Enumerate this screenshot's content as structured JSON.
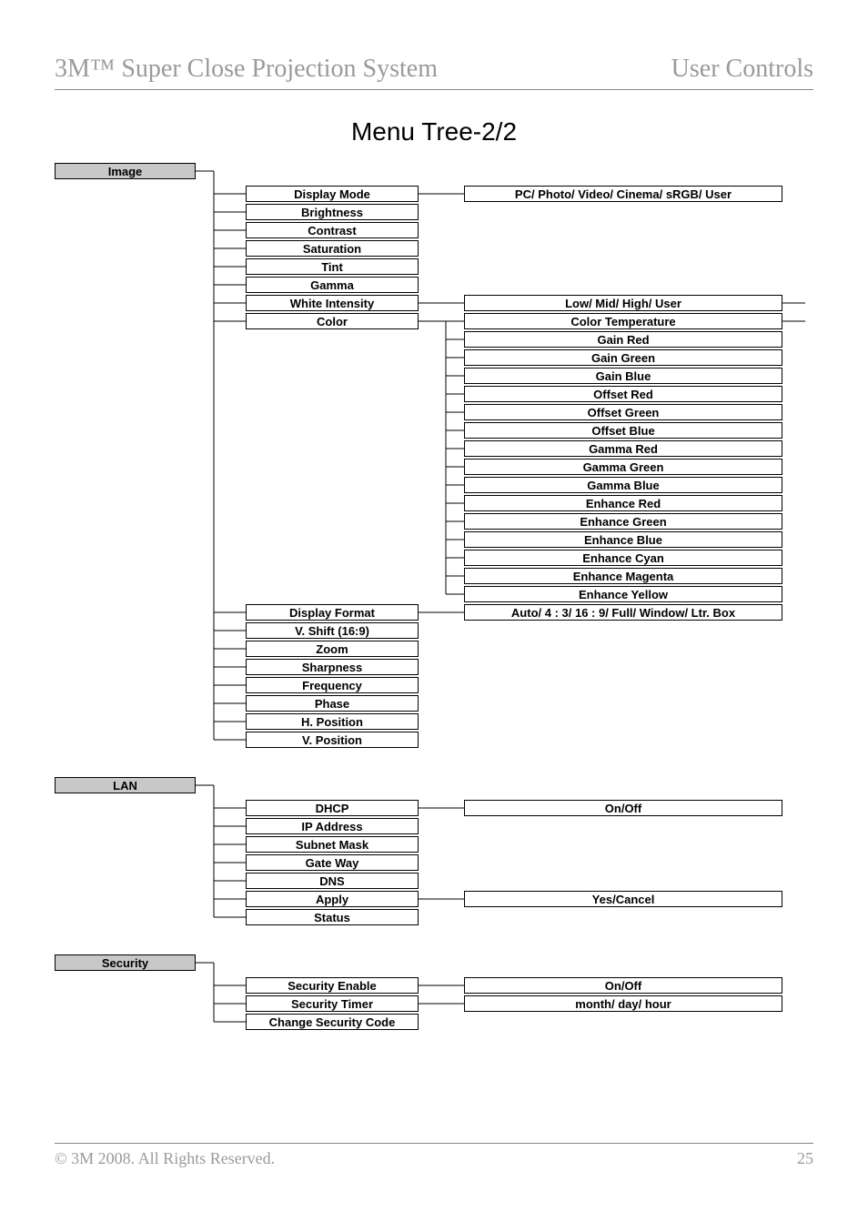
{
  "header": {
    "left": "3M™ Super Close Projection System",
    "right": "User Controls"
  },
  "title": "Menu Tree-2/2",
  "footer": {
    "copyright": "© 3M 2008.  All Rights Reserved.",
    "page": "25"
  },
  "sections": [
    {
      "name": "Image",
      "items": [
        {
          "label": "Display Mode",
          "children": [
            "PC/ Photo/ Video/ Cinema/ sRGB/ User"
          ]
        },
        {
          "label": "Brightness"
        },
        {
          "label": "Contrast"
        },
        {
          "label": "Saturation"
        },
        {
          "label": "Tint"
        },
        {
          "label": "Gamma"
        },
        {
          "label": "White Intensity",
          "children": [
            "Low/ Mid/ High/ User"
          ],
          "childConnectRight": true
        },
        {
          "label": "Color",
          "children": [
            "Color Temperature",
            "Gain Red",
            "Gain Green",
            "Gain Blue",
            "Offset Red",
            "Offset Green",
            "Offset Blue",
            "Gamma Red",
            "Gamma Green",
            "Gamma Blue",
            "Enhance Red",
            "Enhance Green",
            "Enhance Blue",
            "Enhance Cyan",
            "Enhance Magenta",
            "Enhance Yellow"
          ],
          "childConnectRightFirst": true
        },
        {
          "label": "Display Format",
          "children": [
            "Auto/ 4 : 3/ 16 : 9/ Full/ Window/ Ltr. Box"
          ]
        },
        {
          "label": "V. Shift (16:9)"
        },
        {
          "label": "Zoom"
        },
        {
          "label": "Sharpness"
        },
        {
          "label": "Frequency"
        },
        {
          "label": "Phase"
        },
        {
          "label": "H. Position"
        },
        {
          "label": "V. Position"
        }
      ]
    },
    {
      "name": "LAN",
      "items": [
        {
          "label": "DHCP",
          "children": [
            "On/Off"
          ]
        },
        {
          "label": "IP Address"
        },
        {
          "label": "Subnet Mask"
        },
        {
          "label": "Gate Way"
        },
        {
          "label": "DNS"
        },
        {
          "label": "Apply",
          "children": [
            "Yes/Cancel"
          ]
        },
        {
          "label": "Status"
        }
      ]
    },
    {
      "name": "Security",
      "items": [
        {
          "label": "Security Enable",
          "children": [
            "On/Off"
          ]
        },
        {
          "label": "Security Timer",
          "children": [
            "month/ day/ hour"
          ]
        },
        {
          "label": "Change Security Code"
        }
      ]
    }
  ]
}
